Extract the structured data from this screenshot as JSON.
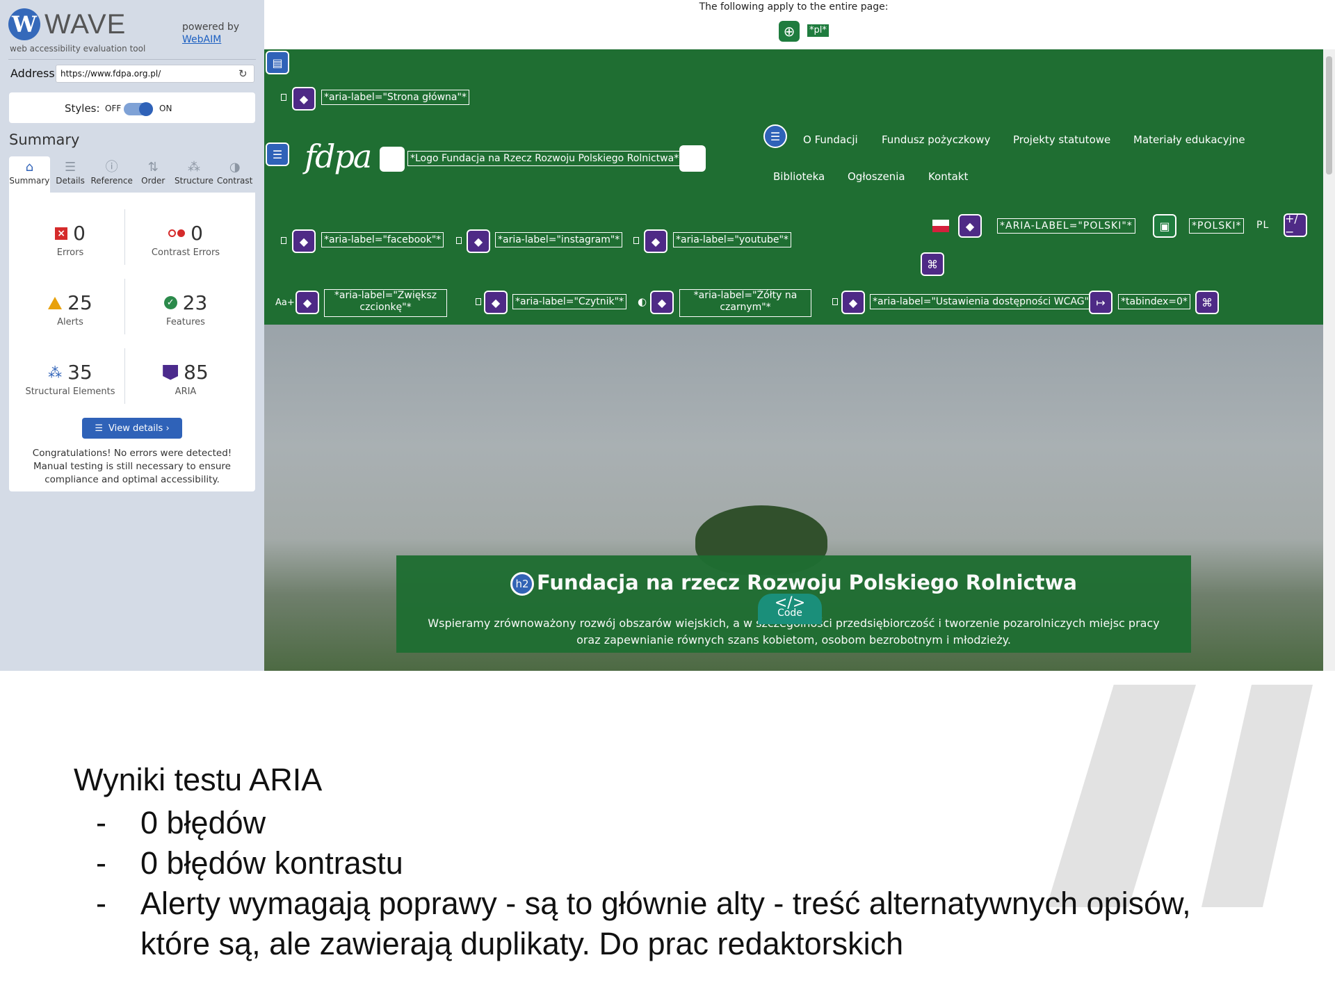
{
  "wave": {
    "logo_letter": "W",
    "logo_text": "WAVE",
    "logo_sub": "web accessibility evaluation tool",
    "powered_by": "powered by",
    "webaim": "WebAIM",
    "address_label": "Address:",
    "address_value": "https://www.fdpa.org.pl/",
    "styles_label": "Styles:",
    "styles_off": "OFF",
    "styles_on": "ON",
    "summary_heading": "Summary",
    "tabs": [
      {
        "label": "Summary",
        "icon": "home-icon"
      },
      {
        "label": "Details",
        "icon": "list-icon"
      },
      {
        "label": "Reference",
        "icon": "info-icon"
      },
      {
        "label": "Order",
        "icon": "order-icon"
      },
      {
        "label": "Structure",
        "icon": "structure-icon"
      },
      {
        "label": "Contrast",
        "icon": "contrast-icon"
      }
    ],
    "stats": {
      "errors": {
        "value": "0",
        "label": "Errors"
      },
      "contrast_errors": {
        "value": "0",
        "label": "Contrast Errors"
      },
      "alerts": {
        "value": "25",
        "label": "Alerts"
      },
      "features": {
        "value": "23",
        "label": "Features"
      },
      "structural": {
        "value": "35",
        "label": "Structural Elements"
      },
      "aria": {
        "value": "85",
        "label": "ARIA"
      }
    },
    "view_details": "View details ›",
    "congrats": "Congratulations! No errors were detected! Manual testing is still necessary to ensure compliance and optimal accessibility."
  },
  "page": {
    "applies_text": "The following apply to the entire page:",
    "lang_tag": "*pl*",
    "labels": {
      "home": "*aria-label=\"Strona główna\"*",
      "logo": "*Logo Fundacja na Rzecz Rozwoju Polskiego Rolnictwa*",
      "facebook": "*aria-label=\"facebook\"*",
      "instagram": "*aria-label=\"instagram\"*",
      "youtube": "*aria-label=\"youtube\"*",
      "aria_polski": "*ARIA-LABEL=\"POLSKI\"*",
      "polski": "*POLSKI*",
      "lang_code": "PL",
      "font_btn": "Aa+",
      "zwieksz": "*aria-label=\"Zwiększ czcionkę\"*",
      "czytnik": "*aria-label=\"Czytnik\"*",
      "zolty": "*aria-label=\"Żółty na czarnym\"*",
      "wcag": "*aria-label=\"Ustawienia dostępności WCAG\"*",
      "tabindex": "*tabindex=0*",
      "plusminus": "+/−"
    },
    "logo_text": "fdpa",
    "nav": [
      "O Fundacji",
      "Fundusz pożyczkowy",
      "Projekty statutowe",
      "Materiały edukacyjne",
      "Biblioteka",
      "Ogłoszenia",
      "Kontakt"
    ],
    "hero_title": "Fundacja na rzecz Rozwoju Polskiego Rolnictwa",
    "hero_h2": "h2",
    "hero_sub_1": "Wspieramy zrównoważony rozwój obszarów wiejskich, a w szczególności przedsiębiorczość i tworzenie pozarolniczych miejsc pracy",
    "hero_sub_2": "oraz zapewnianie równych szans kobietom, osobom bezrobotnym i młodzieży.",
    "code_tag": "</>",
    "code_label": "Code"
  },
  "slide": {
    "title": "Wyniki testu ARIA",
    "bullet": "-",
    "items": [
      "0 błędów",
      "0 błędów kontrastu",
      "Alerty wymagają poprawy - są to głównie alty - treść alternatywnych opisów,",
      "które są, ale zawierają duplikaty. Do prac redaktorskich"
    ]
  },
  "colors": {
    "site_green": "#1f6e32",
    "wave_blue": "#2f62b8",
    "aria_purple": "#4e2a86",
    "sidebar_bg": "#d4dbe6"
  }
}
